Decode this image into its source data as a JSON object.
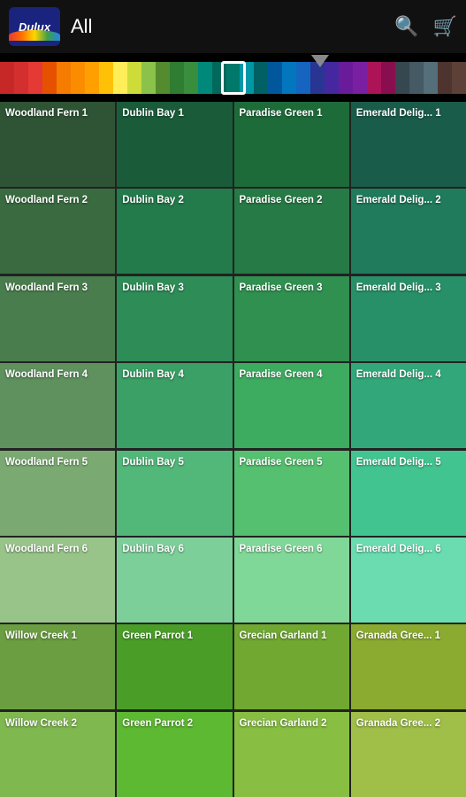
{
  "header": {
    "logo_text": "Dulux",
    "title": "All",
    "search_label": "search",
    "cart_label": "cart"
  },
  "color_strip": {
    "colors": [
      "#c62828",
      "#d32f2f",
      "#e53935",
      "#e65100",
      "#f57c00",
      "#fb8c00",
      "#ffa000",
      "#ffc107",
      "#ffee58",
      "#cddc39",
      "#8bc34a",
      "#558b2f",
      "#2e7d32",
      "#388e3c",
      "#00897b",
      "#00695c",
      "#00796b",
      "#0097a7",
      "#006064",
      "#01579b",
      "#0277bd",
      "#1565c0",
      "#283593",
      "#4527a0",
      "#6a1b9a",
      "#7b1fa2",
      "#ad1457",
      "#880e4f",
      "#37474f",
      "#455a64",
      "#546e7a",
      "#4e342e",
      "#5d4037"
    ]
  },
  "cells": [
    {
      "id": "wf1",
      "label": "Woodland Fern 1",
      "color": "#2e5435"
    },
    {
      "id": "db1",
      "label": "Dublin Bay 1",
      "color": "#1a5c3a"
    },
    {
      "id": "pg1",
      "label": "Paradise Green 1",
      "color": "#1e6b3a"
    },
    {
      "id": "ed1",
      "label": "Emerald Delig... 1",
      "color": "#1a5c4a"
    },
    {
      "id": "wf2",
      "label": "Woodland Fern 2",
      "color": "#3a6b40"
    },
    {
      "id": "db2",
      "label": "Dublin Bay 2",
      "color": "#237a4a"
    },
    {
      "id": "pg2",
      "label": "Paradise Green 2",
      "color": "#267a45"
    },
    {
      "id": "ed2",
      "label": "Emerald Delig... 2",
      "color": "#207a5c"
    },
    {
      "id": "wf3",
      "label": "Woodland Fern 3",
      "color": "#4a7d4e"
    },
    {
      "id": "db3",
      "label": "Dublin Bay 3",
      "color": "#2e8c57"
    },
    {
      "id": "pg3",
      "label": "Paradise Green 3",
      "color": "#309050"
    },
    {
      "id": "ed3",
      "label": "Emerald Delig... 3",
      "color": "#289068"
    },
    {
      "id": "wf4",
      "label": "Woodland Fern 4",
      "color": "#5e915e"
    },
    {
      "id": "db4",
      "label": "Dublin Bay 4",
      "color": "#3aa065"
    },
    {
      "id": "pg4",
      "label": "Paradise Green 4",
      "color": "#3dab60"
    },
    {
      "id": "ed4",
      "label": "Emerald Delig... 4",
      "color": "#32a87a"
    },
    {
      "id": "wf5",
      "label": "Woodland Fern 5",
      "color": "#7aaa72"
    },
    {
      "id": "db5",
      "label": "Dublin Bay 5",
      "color": "#52b87a"
    },
    {
      "id": "pg5",
      "label": "Paradise Green 5",
      "color": "#55c070"
    },
    {
      "id": "ed5",
      "label": "Emerald Delig... 5",
      "color": "#42c490"
    },
    {
      "id": "wf6",
      "label": "Woodland Fern 6",
      "color": "#98c48a"
    },
    {
      "id": "db6",
      "label": "Dublin Bay 6",
      "color": "#7dcf9a"
    },
    {
      "id": "pg6",
      "label": "Paradise Green 6",
      "color": "#80d898"
    },
    {
      "id": "ed6",
      "label": "Emerald Delig... 6",
      "color": "#6adcb0"
    },
    {
      "id": "wc1",
      "label": "Willow Creek 1",
      "color": "#6a9e40"
    },
    {
      "id": "gp1",
      "label": "Green Parrot 1",
      "color": "#4a9e28"
    },
    {
      "id": "gg1",
      "label": "Grecian Garland 1",
      "color": "#70a832"
    },
    {
      "id": "gr1",
      "label": "Granada Gree... 1",
      "color": "#8aaa30"
    },
    {
      "id": "wc2",
      "label": "Willow Creek 2",
      "color": "#80b850"
    },
    {
      "id": "gp2",
      "label": "Green Parrot 2",
      "color": "#5db832"
    },
    {
      "id": "gg2",
      "label": "Grecian Garland 2",
      "color": "#88bf42"
    },
    {
      "id": "gr2",
      "label": "Granada Gree... 2",
      "color": "#a0bf48"
    }
  ]
}
